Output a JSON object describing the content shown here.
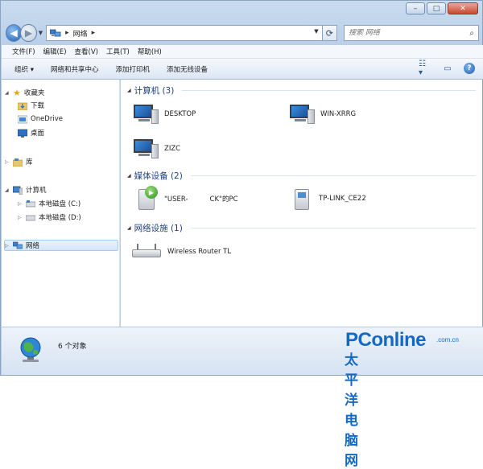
{
  "window": {
    "controls": {
      "minimize": "–",
      "maximize": "□",
      "close": "✕"
    }
  },
  "navbar": {
    "back_icon": "back-arrow-icon",
    "forward_icon": "forward-arrow-icon",
    "breadcrumb": [
      "网络"
    ],
    "refresh_icon": "refresh-icon",
    "search_placeholder": "搜索 网络"
  },
  "menubar": {
    "items": [
      "文件(F)",
      "编辑(E)",
      "查看(V)",
      "工具(T)",
      "帮助(H)"
    ]
  },
  "toolbar": {
    "items": [
      "组织 ▾",
      "网络和共享中心",
      "添加打印机",
      "添加无线设备"
    ],
    "right_icons": [
      "view-options-icon",
      "preview-pane-icon",
      "help-icon"
    ]
  },
  "sidebar": {
    "favorites_label": "收藏夹",
    "favorites_items": [
      "下载",
      "OneDrive",
      "桌面"
    ],
    "library_label": "库",
    "computer_label": "计算机",
    "computer_items": [
      "本地磁盘 (C:)",
      "本地磁盘 (D:)"
    ],
    "network_label": "网络"
  },
  "content": {
    "groups": [
      {
        "title": "计算机 (3)",
        "items": [
          "DESKTOP",
          "WIN-XRRG",
          "ZIZC"
        ]
      },
      {
        "title": "媒体设备 (2)",
        "items": [
          "\"USER-          CK\"的PC",
          "TP-LINK_CE22"
        ]
      },
      {
        "title": "网络设施 (1)",
        "items": [
          "Wireless Router TL"
        ]
      }
    ]
  },
  "statusbar": {
    "count_text": "6 个对象"
  },
  "watermark": {
    "brand": "PConline",
    "domain": ".com.cn",
    "cn": "太平洋电脑网"
  }
}
